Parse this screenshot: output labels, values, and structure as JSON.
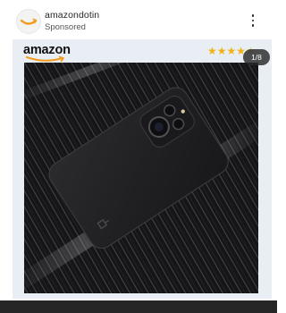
{
  "post": {
    "account_name": "amazondotin",
    "sponsored_label": "Sponsored",
    "more_icon": "more-vertical-icon"
  },
  "ad": {
    "brand": "amazon",
    "rating_stars": 4.5,
    "rating_max": 5,
    "carousel_counter": "1/8",
    "colors": {
      "brand_arrow": "#f29c1f",
      "star": "#f0b313",
      "card_background": "#e9edf4",
      "product_background": "#1c1c1e"
    }
  }
}
